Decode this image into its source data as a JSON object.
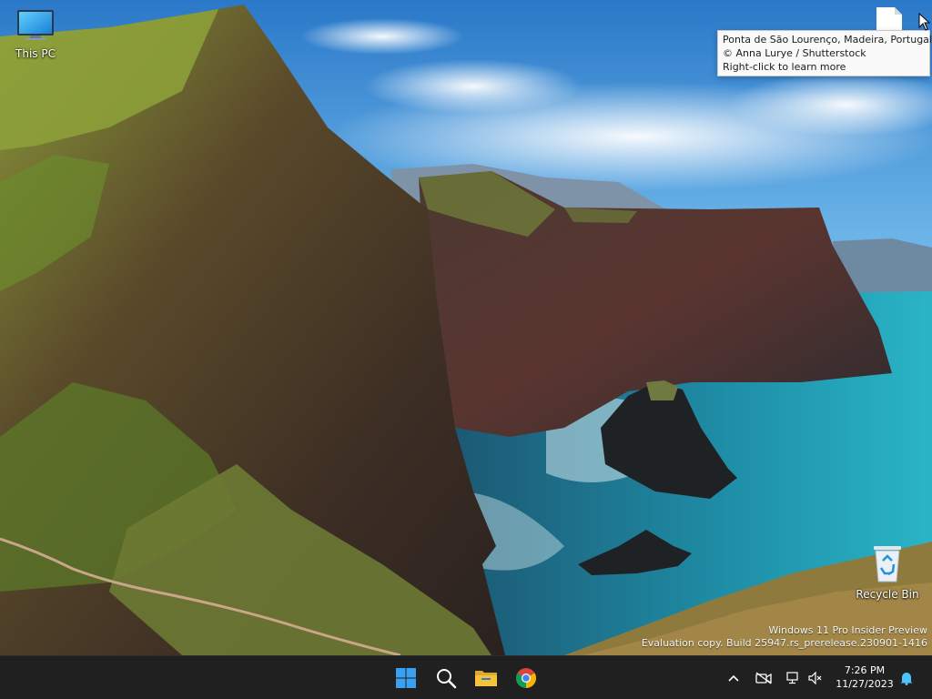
{
  "desktop": {
    "icons": [
      {
        "label": "This PC",
        "icon": "monitor-icon"
      },
      {
        "label": "Recycle Bin",
        "icon": "recycle-bin-icon"
      },
      {
        "label": "",
        "icon": "document-icon"
      }
    ]
  },
  "tooltip": {
    "lines": [
      "Ponta de São Lourenço, Madeira, Portugal",
      "© Anna Lurye / Shutterstock",
      "Right-click to learn more"
    ]
  },
  "watermark": {
    "line1": "Windows 11 Pro Insider Preview",
    "line2": "Evaluation copy. Build 25947.rs_prerelease.230901-1416"
  },
  "taskbar": {
    "apps": [
      {
        "icon": "windows-start-icon"
      },
      {
        "icon": "search-icon"
      },
      {
        "icon": "file-explorer-icon"
      },
      {
        "icon": "chrome-icon"
      }
    ],
    "tray": {
      "time": "7:26 PM",
      "date": "11/27/2023"
    }
  },
  "colors": {
    "taskbar_bg": "#202020",
    "start_blue": "#3aa0f2",
    "folder_yellow": "#f5c33b",
    "notification_blue": "#4cc2ff"
  }
}
